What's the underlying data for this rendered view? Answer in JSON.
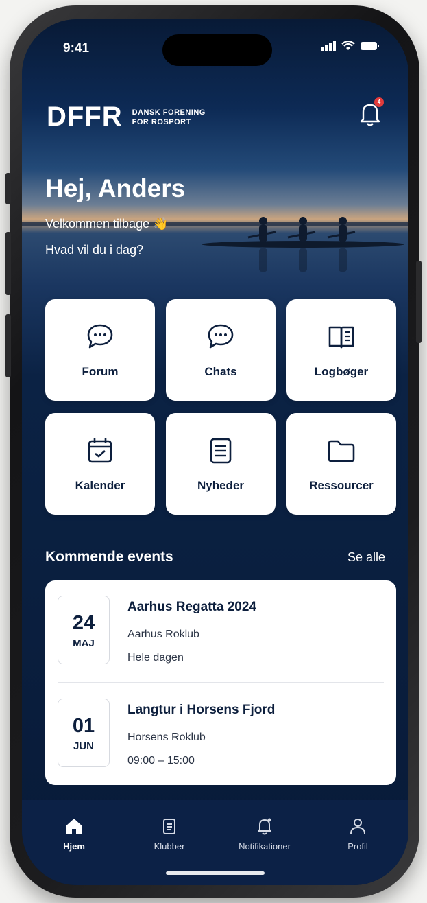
{
  "status_bar": {
    "time": "9:41"
  },
  "header": {
    "logo_mark": "DFFR",
    "logo_line1": "DANSK FORENING",
    "logo_line2": "FOR ROSPORT",
    "notification_count": "4"
  },
  "hero": {
    "greeting": "Hej, Anders",
    "welcome": "Velkommen tilbage 👋",
    "question": "Hvad vil du i dag?"
  },
  "tiles": [
    {
      "label": "Forum",
      "icon": "chat-bubble-icon"
    },
    {
      "label": "Chats",
      "icon": "chat-bubble-icon"
    },
    {
      "label": "Logbøger",
      "icon": "open-book-icon"
    },
    {
      "label": "Kalender",
      "icon": "calendar-icon"
    },
    {
      "label": "Nyheder",
      "icon": "document-icon"
    },
    {
      "label": "Ressourcer",
      "icon": "folder-icon"
    }
  ],
  "events": {
    "title": "Kommende events",
    "see_all": "Se alle",
    "items": [
      {
        "day": "24",
        "month": "MAJ",
        "title": "Aarhus Regatta 2024",
        "club": "Aarhus Roklub",
        "time": "Hele dagen"
      },
      {
        "day": "01",
        "month": "JUN",
        "title": "Langtur i Horsens Fjord",
        "club": "Horsens Roklub",
        "time": "09:00 – 15:00"
      }
    ]
  },
  "tabbar": [
    {
      "label": "Hjem",
      "icon": "home-icon",
      "active": true
    },
    {
      "label": "Klubber",
      "icon": "clipboard-icon",
      "active": false
    },
    {
      "label": "Notifikationer",
      "icon": "bell-icon",
      "active": false
    },
    {
      "label": "Profil",
      "icon": "person-icon",
      "active": false
    }
  ],
  "colors": {
    "navy": "#0b2244",
    "tile_text": "#0d1f3d",
    "badge_red": "#e23b3b",
    "white": "#ffffff"
  }
}
